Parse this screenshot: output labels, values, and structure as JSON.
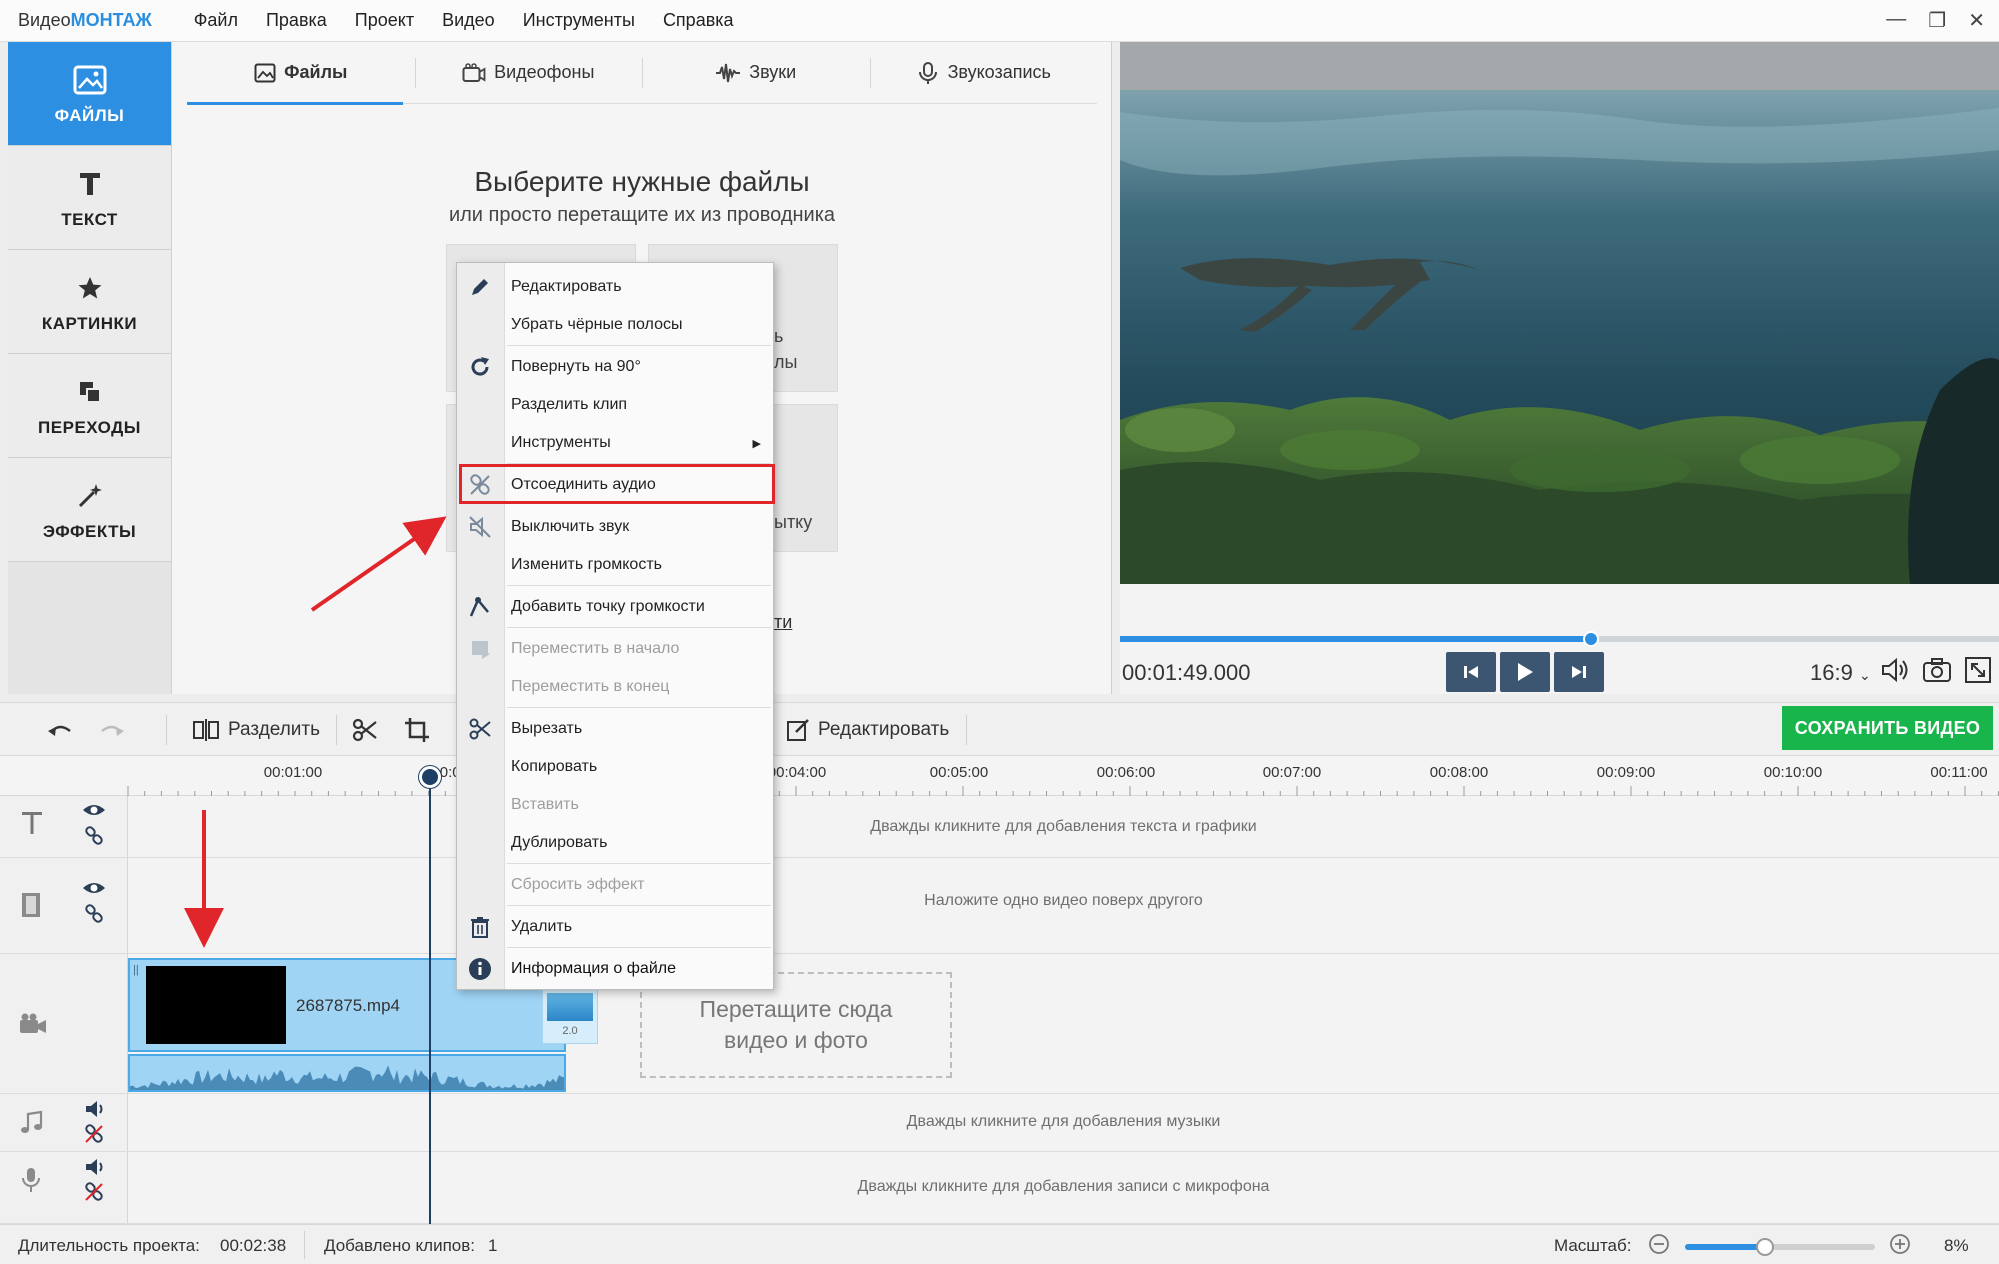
{
  "app": {
    "brand_part1": "Видео",
    "brand_part2": "МОНТАЖ",
    "menu": [
      "Файл",
      "Правка",
      "Проект",
      "Видео",
      "Инструменты",
      "Справка"
    ]
  },
  "sidebar": {
    "items": [
      {
        "label": "ФАЙЛЫ",
        "icon": "image-icon",
        "active": true
      },
      {
        "label": "ТЕКСТ",
        "icon": "text-t-icon",
        "active": false
      },
      {
        "label": "КАРТИНКИ",
        "icon": "star-icon",
        "active": false
      },
      {
        "label": "ПЕРЕХОДЫ",
        "icon": "transitions-icon",
        "active": false
      },
      {
        "label": "ЭФФЕКТЫ",
        "icon": "magic-wand-icon",
        "active": false
      }
    ]
  },
  "panel": {
    "tabs": [
      {
        "label": "Файлы",
        "icon": "image-icon",
        "active": true
      },
      {
        "label": "Видеофоны",
        "icon": "video-bg-icon",
        "active": false
      },
      {
        "label": "Звуки",
        "icon": "sound-wave-icon",
        "active": false
      },
      {
        "label": "Звукозапись",
        "icon": "microphone-icon",
        "active": false
      }
    ],
    "title": "Выберите нужные файлы",
    "subtitle": "или просто перетащите их из проводника",
    "tile_fragments": [
      "ь",
      "лы",
      "ытку",
      "ти"
    ]
  },
  "preview": {
    "timecode": "00:01:49.000",
    "progress_fraction": 0.536,
    "aspect_ratio": "16:9"
  },
  "toolbar": {
    "split_label": "Разделить",
    "edit_label": "Редактировать",
    "save_label": "СОХРАНИТЬ ВИДЕО",
    "save_color": "#17b54b"
  },
  "ruler": {
    "ticks": [
      "00:01:00",
      "00:0",
      "00:04:00",
      "00:05:00",
      "00:06:00",
      "00:07:00",
      "00:08:00",
      "00:09:00",
      "00:10:00",
      "00:11:00"
    ]
  },
  "tracks": {
    "text_hint": "Дважды кликните для добавления текста и графики",
    "overlay_hint": "Наложите одно видео поверх другого",
    "music_hint": "Дважды кликните для добавления музыки",
    "mic_hint": "Дважды кликните для добавления записи с микрофона",
    "clip_name": "2687875.mp4",
    "transition_value": "2.0",
    "drop_line1": "Перетащите сюда",
    "drop_line2": "видео и фото"
  },
  "context_menu": {
    "items": [
      {
        "label": "Редактировать",
        "icon": "pencil-icon",
        "disabled": false
      },
      {
        "label": "Убрать чёрные полосы",
        "icon": "",
        "disabled": false
      },
      {
        "label": "Повернуть на 90°",
        "icon": "rotate-icon",
        "disabled": false
      },
      {
        "label": "Разделить клип",
        "icon": "",
        "disabled": false
      },
      {
        "label": "Инструменты",
        "icon": "",
        "disabled": false,
        "submenu": true
      },
      {
        "label": "Отсоединить аудио",
        "icon": "unlink-icon",
        "disabled": false,
        "highlighted": true
      },
      {
        "label": "Выключить звук",
        "icon": "mute-icon",
        "disabled": false
      },
      {
        "label": "Изменить громкость",
        "icon": "",
        "disabled": false
      },
      {
        "label": "Добавить точку громкости",
        "icon": "volume-point-icon",
        "disabled": false
      },
      {
        "label": "Переместить в начало",
        "icon": "move-start-icon",
        "disabled": true
      },
      {
        "label": "Переместить в конец",
        "icon": "",
        "disabled": true
      },
      {
        "label": "Вырезать",
        "icon": "scissors-icon",
        "disabled": false
      },
      {
        "label": "Копировать",
        "icon": "",
        "disabled": false
      },
      {
        "label": "Вставить",
        "icon": "",
        "disabled": true
      },
      {
        "label": "Дублировать",
        "icon": "",
        "disabled": false
      },
      {
        "label": "Сбросить эффект",
        "icon": "",
        "disabled": true
      },
      {
        "label": "Удалить",
        "icon": "trash-icon",
        "disabled": false
      },
      {
        "label": "Информация о файле",
        "icon": "info-icon",
        "disabled": false
      }
    ],
    "highlight_color": "#e0262b"
  },
  "status": {
    "duration_label": "Длительность проекта:",
    "duration_value": "00:02:38",
    "clips_label": "Добавлено клипов:",
    "clips_value": "1",
    "zoom_label": "Масштаб:",
    "zoom_value": "8%",
    "zoom_fraction": 0.42
  },
  "colors": {
    "accent": "#2c8fe2",
    "annotation_arrow": "#e0262b"
  }
}
